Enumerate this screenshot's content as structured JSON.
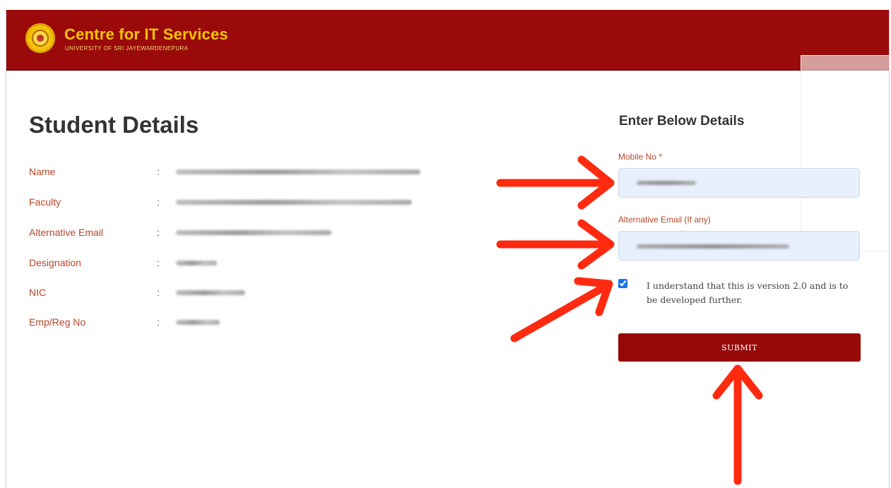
{
  "header": {
    "title": "Centre for IT Services",
    "subtitle": "UNIVERSITY OF SRI JAYEWARDENEPURA",
    "logo_icon": "university-seal-icon",
    "background": "#9a0a0a",
    "title_color": "#f5c400"
  },
  "student_details": {
    "title": "Student Details",
    "separator": ":",
    "rows": [
      {
        "label": "Name"
      },
      {
        "label": "Faculty"
      },
      {
        "label": "Alternative Email"
      },
      {
        "label": "Designation"
      },
      {
        "label": "NIC"
      },
      {
        "label": "Emp/Reg No"
      }
    ]
  },
  "form": {
    "title": "Enter Below Details",
    "mobile_label": "Mobile No *",
    "alt_email_label": "Alternative Email (If any)",
    "agree_text": "I understand that this is version 2.0 and is to be developed further.",
    "agree_checked": true,
    "submit_label": "SUBMIT",
    "accent_color": "#960909",
    "label_color": "#b5462b"
  },
  "annotations": {
    "arrow_color": "#ff2a10",
    "arrow_icon": "red-arrow-icon"
  }
}
